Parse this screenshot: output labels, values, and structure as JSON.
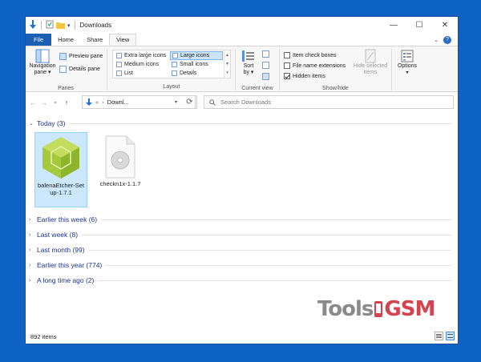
{
  "window": {
    "title": "Downloads"
  },
  "window_controls": {
    "minimize": "—",
    "maximize": "☐",
    "close": "✕"
  },
  "ribbon_tabs": [
    {
      "label": "File"
    },
    {
      "label": "Home"
    },
    {
      "label": "Share"
    },
    {
      "label": "View"
    }
  ],
  "panes_group": {
    "navigation_pane": "Navigation",
    "navigation_pane_line2": "pane",
    "preview_pane": "Preview pane",
    "details_pane": "Details pane",
    "label": "Panes"
  },
  "layout_group": {
    "items": [
      "Extra large icons",
      "Large icons",
      "Medium icons",
      "Small icons",
      "List",
      "Details"
    ],
    "selected": "Large icons",
    "label": "Layout"
  },
  "current_view_group": {
    "sort_by": "Sort",
    "sort_by_line2": "by",
    "label": "Current view"
  },
  "show_hide_group": {
    "item_check_boxes": "Item check boxes",
    "file_name_extensions": "File name extensions",
    "hidden_items": "Hidden items",
    "hidden_items_checked": true,
    "hide_selected": "Hide selected",
    "hide_selected_line2": "items",
    "label": "Show/hide"
  },
  "options_group": {
    "label": "Options"
  },
  "address": {
    "path": "Downl..."
  },
  "search": {
    "placeholder": "Search Downloads"
  },
  "groups": [
    {
      "label": "Today (3)"
    },
    {
      "label": "Earlier this week (6)"
    },
    {
      "label": "Last week (8)"
    },
    {
      "label": "Last month (99)"
    },
    {
      "label": "Earlier this year (774)"
    },
    {
      "label": "A long time ago (2)"
    }
  ],
  "files": [
    {
      "name": "balenaEtcher-Setup-1.7.1",
      "name_line1": "balenaEtcher-Set",
      "name_line2": "up-1.7.1",
      "selected": true
    },
    {
      "name": "checkn1x-1.1.7",
      "selected": false
    }
  ],
  "status": {
    "item_count": "892 items"
  },
  "watermark": {
    "part1": "Tools",
    "part2": "GSM"
  },
  "colors": {
    "accent": "#1a5fb4",
    "background": "#0d62c4",
    "selection": "#cce8ff",
    "group_header": "#1e3287",
    "watermark_red": "#d44450"
  }
}
